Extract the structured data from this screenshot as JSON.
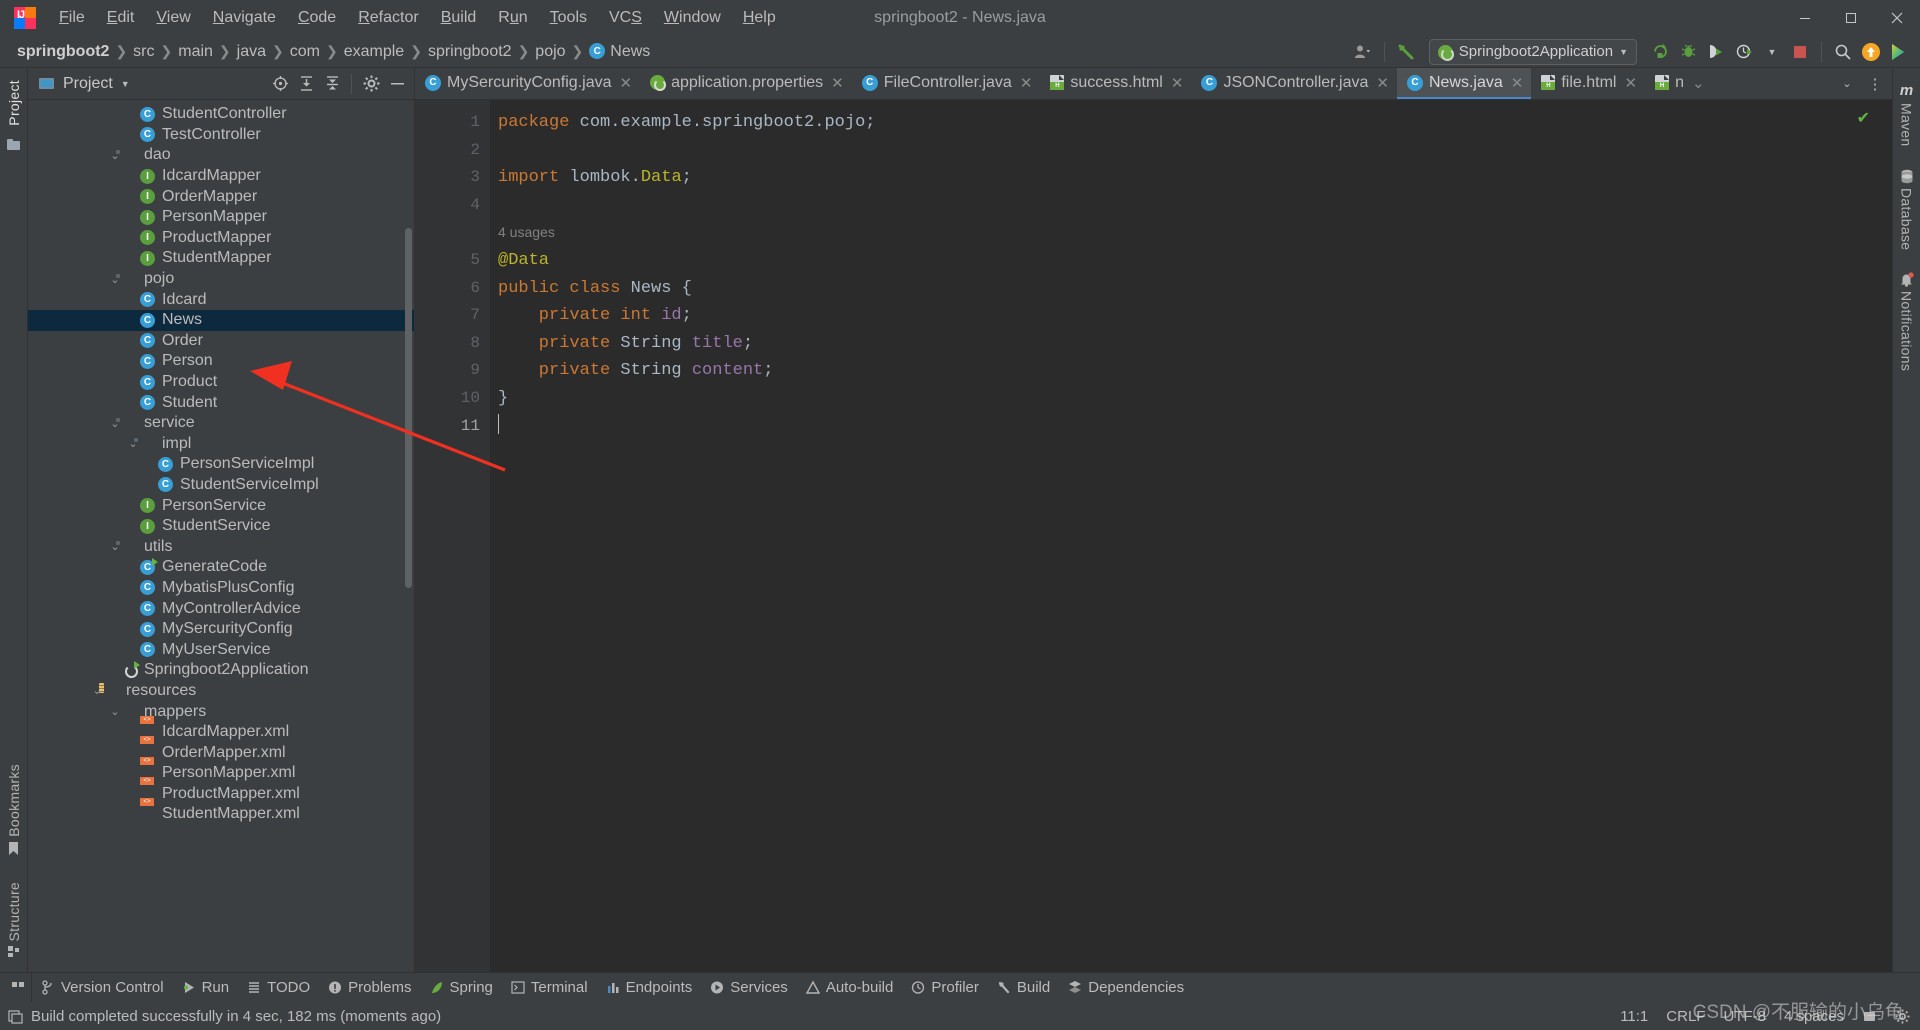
{
  "window": {
    "title": "springboot2 - News.java",
    "controls": [
      "minimize",
      "maximize",
      "close"
    ]
  },
  "menu": [
    {
      "label": "File",
      "mnemonic": "F"
    },
    {
      "label": "Edit",
      "mnemonic": "E"
    },
    {
      "label": "View",
      "mnemonic": "V"
    },
    {
      "label": "Navigate",
      "mnemonic": "N"
    },
    {
      "label": "Code",
      "mnemonic": "C"
    },
    {
      "label": "Refactor",
      "mnemonic": "R"
    },
    {
      "label": "Build",
      "mnemonic": "B"
    },
    {
      "label": "Run",
      "mnemonic": "u"
    },
    {
      "label": "Tools",
      "mnemonic": "T"
    },
    {
      "label": "VCS",
      "mnemonic": "S"
    },
    {
      "label": "Window",
      "mnemonic": "W"
    },
    {
      "label": "Help",
      "mnemonic": "H"
    }
  ],
  "breadcrumbs": [
    {
      "label": "springboot2",
      "bold": true,
      "icon": ""
    },
    {
      "label": "src",
      "bold": false,
      "icon": ""
    },
    {
      "label": "main",
      "bold": false,
      "icon": ""
    },
    {
      "label": "java",
      "bold": false,
      "icon": ""
    },
    {
      "label": "com",
      "bold": false,
      "icon": ""
    },
    {
      "label": "example",
      "bold": false,
      "icon": ""
    },
    {
      "label": "springboot2",
      "bold": false,
      "icon": ""
    },
    {
      "label": "pojo",
      "bold": false,
      "icon": ""
    },
    {
      "label": "News",
      "bold": false,
      "icon": "class-icon"
    }
  ],
  "toolbar": {
    "run_configuration": "Springboot2Application",
    "icons": [
      "account-icon",
      "hammer-build-icon",
      "rerun-icon",
      "debug-icon",
      "run-with-coverage-icon",
      "profiler-dropdown-icon",
      "stop-icon",
      "search-everywhere-icon",
      "updates-icon",
      "ide-assistant-icon"
    ]
  },
  "left_strip": {
    "items": [
      {
        "label": "Project",
        "icon": "project-icon",
        "active": true
      }
    ],
    "bottom_items": [
      {
        "label": "Bookmarks",
        "icon": "bookmark-icon"
      },
      {
        "label": "Structure",
        "icon": "structure-icon"
      }
    ]
  },
  "right_strip": {
    "items": [
      {
        "label": "Maven",
        "icon": "maven-icon"
      },
      {
        "label": "Database",
        "icon": "database-icon"
      },
      {
        "label": "Notifications",
        "icon": "notifications-icon"
      }
    ]
  },
  "project_panel": {
    "title": "Project",
    "header_icons": [
      "locate-icon",
      "expand-all-icon",
      "collapse-all-icon",
      "settings-gear-icon",
      "hide-icon"
    ],
    "tree": [
      {
        "label": "StudentController",
        "indent": 5,
        "icon": "class",
        "chev": "",
        "selected": false
      },
      {
        "label": "TestController",
        "indent": 5,
        "icon": "class",
        "chev": "",
        "selected": false
      },
      {
        "label": "dao",
        "indent": 4,
        "icon": "folder",
        "chev": "v",
        "selected": false
      },
      {
        "label": "IdcardMapper",
        "indent": 5,
        "icon": "interface",
        "chev": "",
        "selected": false
      },
      {
        "label": "OrderMapper",
        "indent": 5,
        "icon": "interface",
        "chev": "",
        "selected": false
      },
      {
        "label": "PersonMapper",
        "indent": 5,
        "icon": "interface",
        "chev": "",
        "selected": false
      },
      {
        "label": "ProductMapper",
        "indent": 5,
        "icon": "interface",
        "chev": "",
        "selected": false
      },
      {
        "label": "StudentMapper",
        "indent": 5,
        "icon": "interface",
        "chev": "",
        "selected": false
      },
      {
        "label": "pojo",
        "indent": 4,
        "icon": "folder",
        "chev": "v",
        "selected": false
      },
      {
        "label": "Idcard",
        "indent": 5,
        "icon": "class",
        "chev": "",
        "selected": false
      },
      {
        "label": "News",
        "indent": 5,
        "icon": "class",
        "chev": "",
        "selected": true
      },
      {
        "label": "Order",
        "indent": 5,
        "icon": "class",
        "chev": "",
        "selected": false
      },
      {
        "label": "Person",
        "indent": 5,
        "icon": "class",
        "chev": "",
        "selected": false
      },
      {
        "label": "Product",
        "indent": 5,
        "icon": "class",
        "chev": "",
        "selected": false
      },
      {
        "label": "Student",
        "indent": 5,
        "icon": "class",
        "chev": "",
        "selected": false
      },
      {
        "label": "service",
        "indent": 4,
        "icon": "folder",
        "chev": "v",
        "selected": false
      },
      {
        "label": "impl",
        "indent": 5,
        "icon": "folder",
        "chev": "v",
        "selected": false
      },
      {
        "label": "PersonServiceImpl",
        "indent": 6,
        "icon": "class",
        "chev": "",
        "selected": false
      },
      {
        "label": "StudentServiceImpl",
        "indent": 6,
        "icon": "class",
        "chev": "",
        "selected": false
      },
      {
        "label": "PersonService",
        "indent": 5,
        "icon": "interface",
        "chev": "",
        "selected": false
      },
      {
        "label": "StudentService",
        "indent": 5,
        "icon": "interface",
        "chev": "",
        "selected": false
      },
      {
        "label": "utils",
        "indent": 4,
        "icon": "folder",
        "chev": "v",
        "selected": false
      },
      {
        "label": "GenerateCode",
        "indent": 5,
        "icon": "class-runnable",
        "chev": "",
        "selected": false
      },
      {
        "label": "MybatisPlusConfig",
        "indent": 5,
        "icon": "class",
        "chev": "",
        "selected": false
      },
      {
        "label": "MyControllerAdvice",
        "indent": 5,
        "icon": "class",
        "chev": "",
        "selected": false
      },
      {
        "label": "MySercurityConfig",
        "indent": 5,
        "icon": "class",
        "chev": "",
        "selected": false
      },
      {
        "label": "MyUserService",
        "indent": 5,
        "icon": "class",
        "chev": "",
        "selected": false
      },
      {
        "label": "Springboot2Application",
        "indent": 4,
        "icon": "spring-runnable",
        "chev": "",
        "selected": false
      },
      {
        "label": "resources",
        "indent": 3,
        "icon": "resources",
        "chev": "v",
        "selected": false
      },
      {
        "label": "mappers",
        "indent": 4,
        "icon": "folder-plain",
        "chev": "v",
        "selected": false
      },
      {
        "label": "IdcardMapper.xml",
        "indent": 5,
        "icon": "xml",
        "chev": "",
        "selected": false
      },
      {
        "label": "OrderMapper.xml",
        "indent": 5,
        "icon": "xml",
        "chev": "",
        "selected": false
      },
      {
        "label": "PersonMapper.xml",
        "indent": 5,
        "icon": "xml",
        "chev": "",
        "selected": false
      },
      {
        "label": "ProductMapper.xml",
        "indent": 5,
        "icon": "xml",
        "chev": "",
        "selected": false
      },
      {
        "label": "StudentMapper.xml",
        "indent": 5,
        "icon": "xml",
        "chev": "",
        "selected": false
      }
    ]
  },
  "editor_tabs": [
    {
      "label": "MySercurityConfig.java",
      "icon": "class",
      "active": false,
      "closable": true
    },
    {
      "label": "application.properties",
      "icon": "spring-props",
      "active": false,
      "closable": true
    },
    {
      "label": "FileController.java",
      "icon": "class",
      "active": false,
      "closable": true
    },
    {
      "label": "success.html",
      "icon": "html",
      "active": false,
      "closable": true
    },
    {
      "label": "JSONController.java",
      "icon": "class",
      "active": false,
      "closable": true
    },
    {
      "label": "News.java",
      "icon": "class",
      "active": true,
      "closable": true
    },
    {
      "label": "file.html",
      "icon": "html",
      "active": false,
      "closable": true
    },
    {
      "label": "n",
      "icon": "html",
      "active": false,
      "closable": false
    }
  ],
  "editor": {
    "file": "News.java",
    "inlay_hint": "4 usages",
    "inlay_hint_line": 5,
    "line_numbers": [
      1,
      2,
      3,
      4,
      5,
      6,
      7,
      8,
      9,
      10,
      11
    ],
    "lines": [
      {
        "n": 1,
        "tokens": [
          {
            "t": "package",
            "c": "kw"
          },
          {
            "t": " com.example.springboot2.pojo;",
            "c": "cls"
          }
        ]
      },
      {
        "n": 2,
        "tokens": []
      },
      {
        "n": 3,
        "tokens": [
          {
            "t": "import",
            "c": "kw"
          },
          {
            "t": " lombok.",
            "c": "cls"
          },
          {
            "t": "Data",
            "c": "ann"
          },
          {
            "t": ";",
            "c": "cls"
          }
        ]
      },
      {
        "n": 4,
        "tokens": []
      },
      {
        "n": 5,
        "tokens": [
          {
            "t": "@Data",
            "c": "ann"
          }
        ]
      },
      {
        "n": 6,
        "tokens": [
          {
            "t": "public class",
            "c": "kw"
          },
          {
            "t": " News {",
            "c": "cls"
          }
        ]
      },
      {
        "n": 7,
        "tokens": [
          {
            "t": "    private int",
            "c": "kw"
          },
          {
            "t": " ",
            "c": "cls"
          },
          {
            "t": "id",
            "c": "fld"
          },
          {
            "t": ";",
            "c": "cls"
          }
        ]
      },
      {
        "n": 8,
        "tokens": [
          {
            "t": "    private",
            "c": "kw"
          },
          {
            "t": " String ",
            "c": "cls"
          },
          {
            "t": "title",
            "c": "fld"
          },
          {
            "t": ";",
            "c": "cls"
          }
        ]
      },
      {
        "n": 9,
        "tokens": [
          {
            "t": "    private",
            "c": "kw"
          },
          {
            "t": " String ",
            "c": "cls"
          },
          {
            "t": "content",
            "c": "fld"
          },
          {
            "t": ";",
            "c": "cls"
          }
        ]
      },
      {
        "n": 10,
        "tokens": [
          {
            "t": "}",
            "c": "cls"
          }
        ]
      },
      {
        "n": 11,
        "tokens": []
      }
    ],
    "inspection_status": "ok-check-icon"
  },
  "tool_windows": [
    {
      "label": "Version Control",
      "icon": "branch-icon"
    },
    {
      "label": "Run",
      "icon": "run-icon"
    },
    {
      "label": "TODO",
      "icon": "todo-icon"
    },
    {
      "label": "Problems",
      "icon": "problems-icon"
    },
    {
      "label": "Spring",
      "icon": "spring-leaf-icon"
    },
    {
      "label": "Terminal",
      "icon": "terminal-icon"
    },
    {
      "label": "Endpoints",
      "icon": "endpoints-icon"
    },
    {
      "label": "Services",
      "icon": "services-icon"
    },
    {
      "label": "Auto-build",
      "icon": "auto-build-icon"
    },
    {
      "label": "Profiler",
      "icon": "profiler-icon"
    },
    {
      "label": "Build",
      "icon": "build-hammer-icon"
    },
    {
      "label": "Dependencies",
      "icon": "dependencies-icon"
    }
  ],
  "status_bar": {
    "message": "Build completed successfully in 4 sec, 182 ms (moments ago)",
    "message_icon": "build-status-icon",
    "caret_position": "11:1",
    "line_separator": "CRLF",
    "encoding": "UTF-8",
    "indent": "4 spaces",
    "right_icons": [
      "read-only-toggle-icon",
      "settings-gear-icon"
    ]
  },
  "annotations": {
    "watermark": "CSDN @不服输的小乌龟",
    "arrow_color": "#f03020",
    "arrow_label": "pointer-to-news-node"
  },
  "colors": {
    "background": "#3c3f41",
    "editor_background": "#2b2b2b",
    "selection": "#0d293e",
    "accent_blue": "#389fd6",
    "accent_green": "#5a9e3e",
    "keyword_orange": "#cc7832",
    "annotation_yellow": "#bbb529",
    "field_purple": "#9876aa",
    "text": "#a9b7c6"
  }
}
